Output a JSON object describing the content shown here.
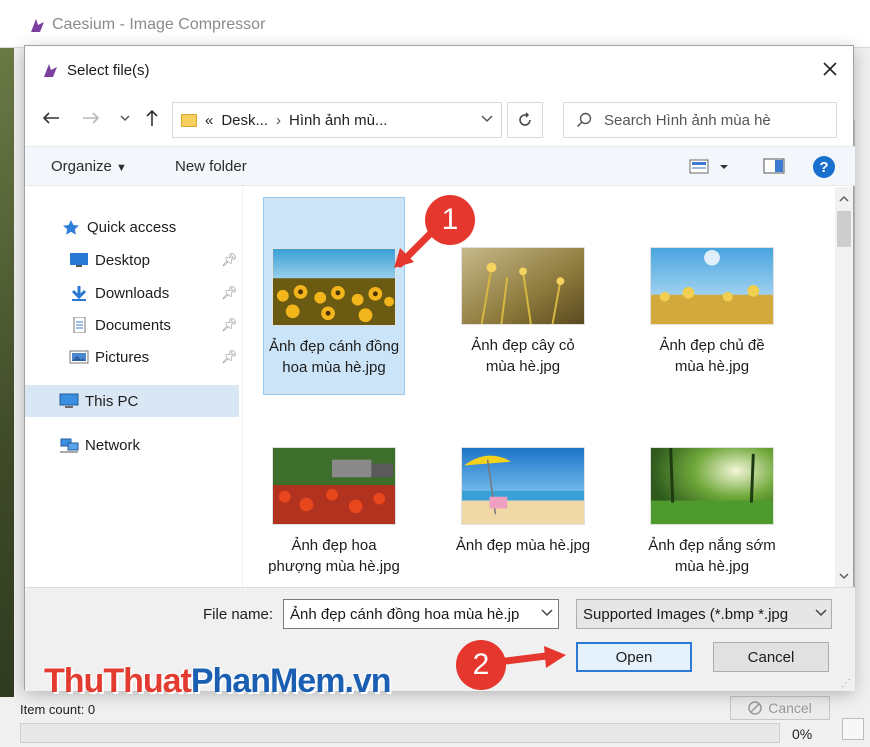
{
  "app": {
    "title": "Caesium - Image Compressor",
    "item_count": "Item count: 0",
    "cancel_label": "Cancel",
    "progress_pct": "0%"
  },
  "dialog": {
    "title": "Select file(s)",
    "address": {
      "chevrons": "«",
      "segment1": "Desk...",
      "segment2": "Hình ảnh mù..."
    },
    "search_placeholder": "Search Hình ảnh mùa hè",
    "toolbar": {
      "organize": "Organize",
      "new_folder": "New folder",
      "help": "?"
    },
    "sidebar": {
      "quick_access": "Quick access",
      "desktop": "Desktop",
      "downloads": "Downloads",
      "documents": "Documents",
      "pictures": "Pictures",
      "this_pc": "This PC",
      "network": "Network"
    },
    "files": [
      {
        "name": "Ảnh đẹp cánh đồng hoa mùa hè.jpg"
      },
      {
        "name": "Ảnh đẹp cây cỏ mùa hè.jpg"
      },
      {
        "name": "Ảnh đẹp chủ đề mùa hè.jpg"
      },
      {
        "name": "Ảnh đẹp hoa phượng mùa hè.jpg"
      },
      {
        "name": "Ảnh đẹp mùa hè.jpg"
      },
      {
        "name": "Ảnh đẹp nắng sớm mùa hè.jpg"
      }
    ],
    "file_name_label": "File name:",
    "file_name_value": "Ảnh đẹp cánh đồng hoa mùa hè.jp",
    "filter_value": "Supported Images (*.bmp *.jpg",
    "open_label": "Open",
    "cancel_label": "Cancel"
  },
  "annotations": {
    "badge1": "1",
    "badge2": "2"
  },
  "watermark": {
    "part1": "Thu",
    "part2": "Thuat",
    "part3": "Phan",
    "part4": "Mem",
    "part5": ".vn"
  },
  "colors": {
    "selection": "#cce4f7",
    "accent": "#2d7ad6",
    "badge": "#e5372d"
  }
}
